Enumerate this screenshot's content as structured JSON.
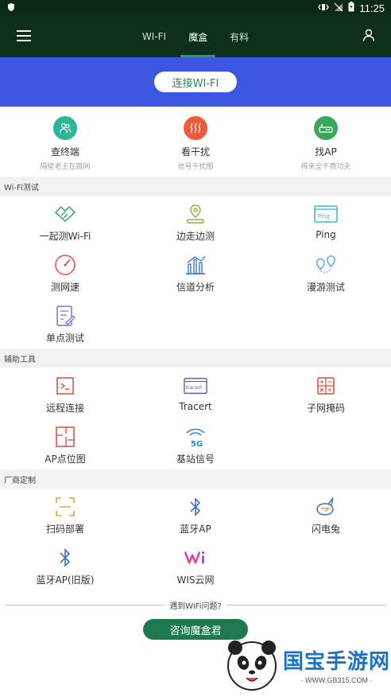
{
  "status_bar": {
    "time": "11:25"
  },
  "header": {
    "tabs": [
      {
        "label": "WI-FI"
      },
      {
        "label": "魔盒"
      },
      {
        "label": "有料"
      }
    ]
  },
  "banner": {
    "connect_label": "连接WI-FI"
  },
  "top_features": [
    {
      "title": "查终端",
      "sub": "隔壁老王在蹭网"
    },
    {
      "title": "看干扰",
      "sub": "信号干扰图"
    },
    {
      "title": "找AP",
      "sub": "得来全不费功夫"
    }
  ],
  "sections": {
    "wifi_test": {
      "title": "Wi-Fi测试",
      "items": [
        {
          "label": "一起测Wi-Fi"
        },
        {
          "label": "边走边测"
        },
        {
          "label": "Ping"
        },
        {
          "label": "测网速"
        },
        {
          "label": "信道分析"
        },
        {
          "label": "漫游测试"
        },
        {
          "label": "单点测试"
        }
      ]
    },
    "tools": {
      "title": "辅助工具",
      "items": [
        {
          "label": "远程连接"
        },
        {
          "label": "Tracert"
        },
        {
          "label": "子网掩码"
        },
        {
          "label": "AP点位图"
        },
        {
          "label": "基站信号"
        }
      ]
    },
    "vendor": {
      "title": "厂商定制",
      "items": [
        {
          "label": "扫码部署"
        },
        {
          "label": "蓝牙AP"
        },
        {
          "label": "闪电兔"
        },
        {
          "label": "蓝牙AP(旧版)"
        },
        {
          "label": "WIS云网"
        }
      ]
    }
  },
  "footer": {
    "question": "遇到WiFi问题?",
    "consult_label": "咨询魔盒君"
  },
  "watermark": {
    "title": "国宝手游网",
    "url": "· WWW.GB315.COM ·"
  }
}
